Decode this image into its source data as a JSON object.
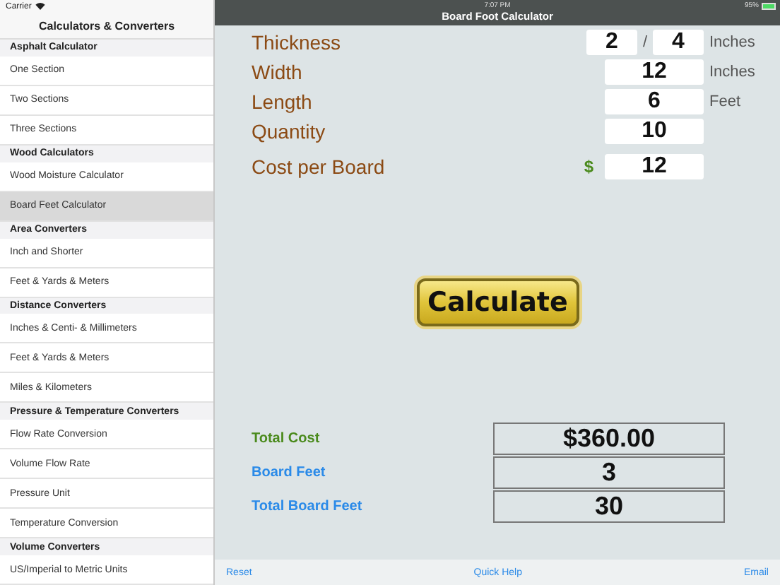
{
  "status_bar": {
    "carrier": "Carrier",
    "time": "7:07 PM",
    "battery": "95%"
  },
  "sidebar": {
    "title": "Calculators & Converters",
    "sections": [
      {
        "header": "Asphalt Calculator",
        "items": [
          {
            "label": "One Section",
            "selected": false
          },
          {
            "label": "Two Sections",
            "selected": false
          },
          {
            "label": "Three Sections",
            "selected": false
          }
        ]
      },
      {
        "header": "Wood Calculators",
        "items": [
          {
            "label": "Wood Moisture Calculator",
            "selected": false
          },
          {
            "label": "Board Feet Calculator",
            "selected": true
          }
        ]
      },
      {
        "header": "Area Converters",
        "items": [
          {
            "label": "Inch and Shorter",
            "selected": false
          },
          {
            "label": "Feet & Yards & Meters",
            "selected": false
          }
        ]
      },
      {
        "header": "Distance Converters",
        "items": [
          {
            "label": "Inches & Centi- & Millimeters",
            "selected": false
          },
          {
            "label": "Feet & Yards & Meters",
            "selected": false
          },
          {
            "label": "Miles & Kilometers",
            "selected": false
          }
        ]
      },
      {
        "header": "Pressure & Temperature Converters",
        "items": [
          {
            "label": "Flow Rate Conversion",
            "selected": false
          },
          {
            "label": "Volume Flow Rate",
            "selected": false
          },
          {
            "label": "Pressure Unit",
            "selected": false
          },
          {
            "label": "Temperature Conversion",
            "selected": false
          }
        ]
      },
      {
        "header": "Volume Converters",
        "items": [
          {
            "label": "US/Imperial to Metric Units",
            "selected": false
          }
        ]
      }
    ]
  },
  "nav_title": "Board Foot Calculator",
  "fields": [
    {
      "kind": "fraction",
      "label": "Thickness",
      "values": [
        "2",
        "4"
      ],
      "separator": "/",
      "unit": "Inches"
    },
    {
      "kind": "number",
      "label": "Width",
      "value": "12",
      "unit": "Inches"
    },
    {
      "kind": "number",
      "label": "Length",
      "value": "6",
      "unit": "Feet"
    },
    {
      "kind": "number",
      "label": "Quantity",
      "value": "10"
    },
    {
      "kind": "money",
      "label": "Cost per Board",
      "prefix": "$",
      "value": "12"
    }
  ],
  "calculate_button": "Calculate",
  "results": [
    {
      "label": "Total Cost",
      "value": "$360.00",
      "color": "#4a8a1c"
    },
    {
      "label": "Board Feet",
      "value": "3",
      "color": "#2a8ae8"
    },
    {
      "label": "Total Board Feet",
      "value": "30",
      "color": "#2a8ae8"
    }
  ],
  "toolbar": [
    "Reset",
    "Quick Help",
    "Email"
  ]
}
